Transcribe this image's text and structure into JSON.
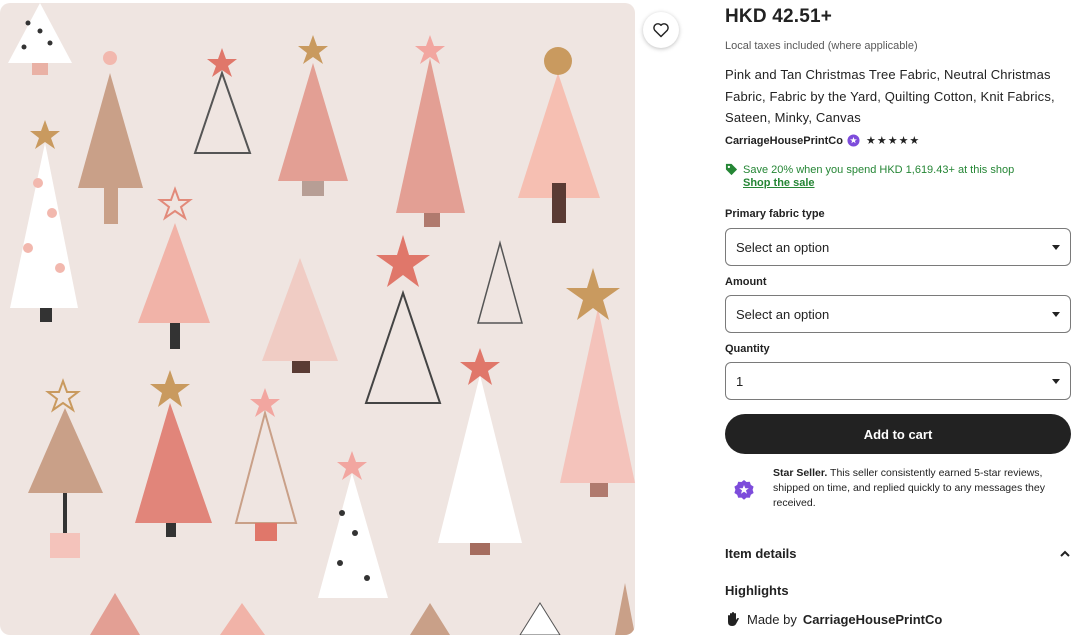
{
  "listing": {
    "price": "HKD 42.51+",
    "tax_note": "Local taxes included (where applicable)",
    "title": "Pink and Tan Christmas Tree Fabric, Neutral Christmas Fabric, Fabric by the Yard, Quilting Cotton, Knit Fabrics, Sateen, Minky, Canvas",
    "seller_name": "CarriageHousePrintCo",
    "rating_stars": "★★★★★"
  },
  "promo": {
    "text": "Save 20% when you spend HKD 1,619.43+ at this shop",
    "link": "Shop the sale",
    "color": "#258635"
  },
  "options": {
    "fabric_type": {
      "label": "Primary fabric type",
      "value": "Select an option"
    },
    "amount": {
      "label": "Amount",
      "value": "Select an option"
    },
    "quantity": {
      "label": "Quantity",
      "value": "1"
    }
  },
  "cart": {
    "label": "Add to cart"
  },
  "star_seller": {
    "title": "Star Seller.",
    "description": "This seller consistently earned 5-star reviews, shipped on time, and replied quickly to any messages they received.",
    "badge_color": "#7d4cdb"
  },
  "details": {
    "item_details_label": "Item details",
    "highlights_label": "Highlights",
    "made_by_prefix": "Made by",
    "made_by_name": "CarriageHousePrintCo"
  },
  "icons": {
    "favorite": "heart-icon",
    "tag": "tag-icon",
    "star_seller": "star-seller-badge-icon",
    "chevron": "chevron-up-icon",
    "made_by": "hand-icon"
  },
  "colors": {
    "fabric_background": "#efe5e1",
    "tree_pink": "#e7a9a0",
    "tree_tan": "#c9a088",
    "star_gold": "#c99a5f",
    "button_dark": "#222222"
  }
}
